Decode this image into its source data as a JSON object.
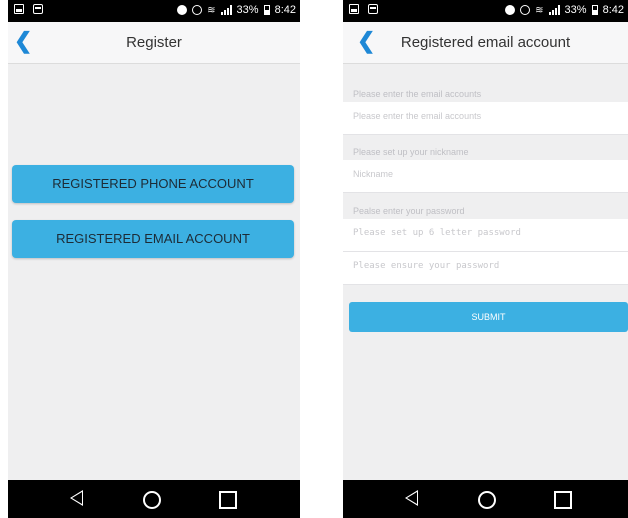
{
  "status_bar": {
    "battery": "33%",
    "time": "8:42"
  },
  "register_screen": {
    "title": "Register",
    "phone_button_label": "REGISTERED PHONE ACCOUNT",
    "email_button_label": "REGISTERED EMAIL ACCOUNT"
  },
  "email_screen": {
    "title": "Registered email account",
    "email_label": "Please enter the email accounts",
    "email_placeholder": "Please enter the email accounts",
    "nickname_label": "Please set up your nickname",
    "nickname_placeholder": "Nickname",
    "password_label": "Pealse enter your password",
    "password_placeholder": "Please set up 6 letter password",
    "confirm_placeholder": "Please ensure your password",
    "submit_label": "SUBMIT"
  },
  "colors": {
    "accent": "#3cb0e2",
    "back_arrow": "#1e88d6",
    "background": "#efeff0"
  },
  "icons": {
    "back": "chevron-left-icon",
    "nav_back": "triangle-back-icon",
    "nav_home": "circle-home-icon",
    "nav_recent": "square-recent-icon"
  }
}
